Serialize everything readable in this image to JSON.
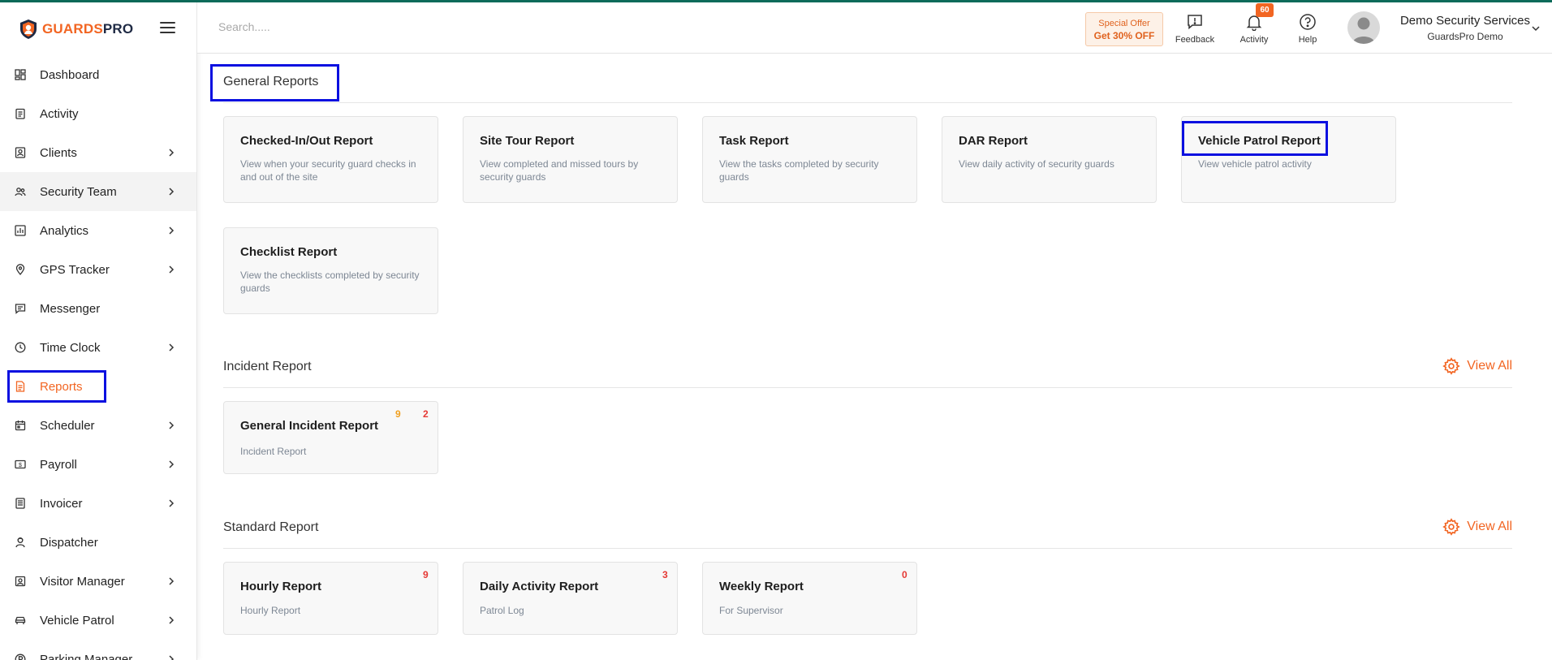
{
  "app": {
    "logo_part1": "GUARDS",
    "logo_part2": "PRO",
    "brand_color": "#f26522",
    "highlight_color": "#0a10e0"
  },
  "sidebar": {
    "items": [
      {
        "label": "Dashboard",
        "icon": "dashboard-icon",
        "has_children": false
      },
      {
        "label": "Activity",
        "icon": "activity-icon",
        "has_children": false
      },
      {
        "label": "Clients",
        "icon": "clients-icon",
        "has_children": true
      },
      {
        "label": "Security Team",
        "icon": "team-icon",
        "has_children": true
      },
      {
        "label": "Analytics",
        "icon": "analytics-icon",
        "has_children": true
      },
      {
        "label": "GPS Tracker",
        "icon": "location-pin-icon",
        "has_children": true
      },
      {
        "label": "Messenger",
        "icon": "message-icon",
        "has_children": false
      },
      {
        "label": "Time Clock",
        "icon": "clock-icon",
        "has_children": true
      },
      {
        "label": "Reports",
        "icon": "report-icon",
        "has_children": false,
        "active": true
      },
      {
        "label": "Scheduler",
        "icon": "calendar-icon",
        "has_children": true
      },
      {
        "label": "Payroll",
        "icon": "payroll-icon",
        "has_children": true
      },
      {
        "label": "Invoicer",
        "icon": "invoice-icon",
        "has_children": true
      },
      {
        "label": "Dispatcher",
        "icon": "dispatcher-icon",
        "has_children": false
      },
      {
        "label": "Visitor Manager",
        "icon": "visitor-icon",
        "has_children": true
      },
      {
        "label": "Vehicle Patrol",
        "icon": "car-icon",
        "has_children": true
      },
      {
        "label": "Parking Manager",
        "icon": "parking-icon",
        "has_children": true
      }
    ]
  },
  "header": {
    "search_placeholder": "Search.....",
    "offer_line1": "Special Offer",
    "offer_line2": "Get 30% OFF",
    "feedback_label": "Feedback",
    "activity_label": "Activity",
    "activity_count": "60",
    "help_label": "Help",
    "user_name": "Demo Security Services",
    "user_company": "GuardsPro Demo"
  },
  "general_reports": {
    "title": "General Reports",
    "cards": [
      {
        "title": "Checked-In/Out Report",
        "desc": "View when your security guard checks in and out of the site"
      },
      {
        "title": "Site Tour Report",
        "desc": "View completed and missed tours by security guards"
      },
      {
        "title": "Task Report",
        "desc": "View the tasks completed by security guards"
      },
      {
        "title": "DAR Report",
        "desc": "View daily activity of security guards"
      },
      {
        "title": "Vehicle Patrol Report",
        "desc": "View vehicle patrol activity"
      },
      {
        "title": "Checklist Report",
        "desc": "View the checklists completed by security guards"
      }
    ]
  },
  "incident_report": {
    "title": "Incident Report",
    "view_all": "View All",
    "cards": [
      {
        "title": "General Incident Report",
        "desc": "Incident Report",
        "count_a": "9",
        "count_b": "2"
      }
    ]
  },
  "standard_report": {
    "title": "Standard Report",
    "view_all": "View All",
    "cards": [
      {
        "title": "Hourly Report",
        "desc": "Hourly Report",
        "count": "9"
      },
      {
        "title": "Daily Activity Report",
        "desc": "Patrol Log",
        "count": "3"
      },
      {
        "title": "Weekly Report",
        "desc": "For Supervisor",
        "count": "0"
      }
    ]
  }
}
